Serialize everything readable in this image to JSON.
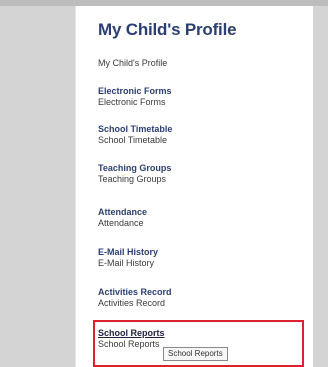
{
  "page_title": "My Child's Profile",
  "first_link": "My Child's Profile",
  "sections": [
    {
      "heading": "Electronic Forms",
      "sub": "Electronic Forms"
    },
    {
      "heading": "School Timetable",
      "sub": "School Timetable"
    },
    {
      "heading": "Teaching Groups",
      "sub": "Teaching Groups"
    },
    {
      "heading": "Attendance",
      "sub": "Attendance"
    },
    {
      "heading": "E-Mail History",
      "sub": "E-Mail History"
    },
    {
      "heading": "Activities Record",
      "sub": "Activities Record"
    },
    {
      "heading": "School Reports",
      "sub": "School Reports"
    }
  ],
  "tooltip": "School Reports",
  "colors": {
    "title": "#2c3f73",
    "highlight_border": "#d9232f",
    "background": "#d4d4d4"
  }
}
